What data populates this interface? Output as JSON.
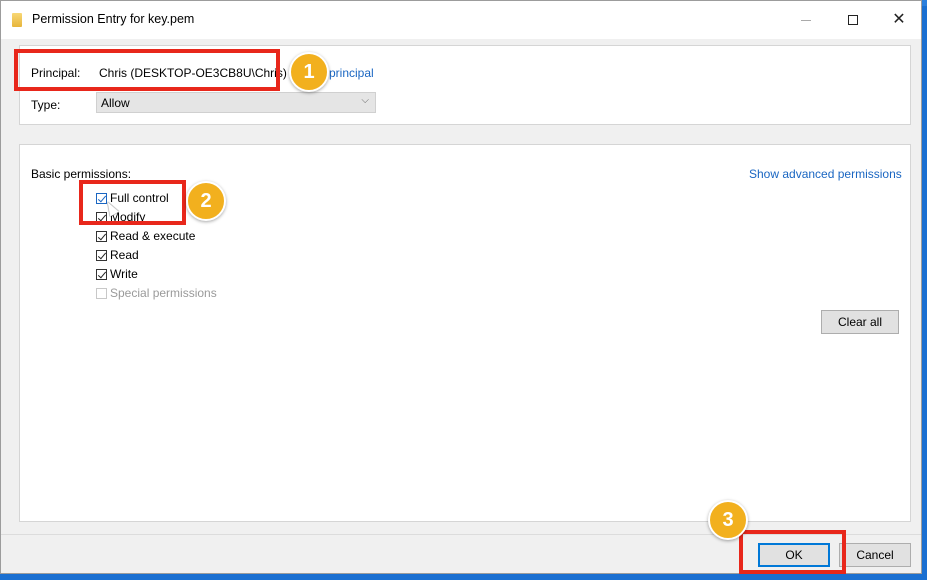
{
  "window": {
    "title": "Permission Entry for key.pem",
    "minimize_label": "—",
    "close_label": "✕"
  },
  "principal": {
    "label": "Principal:",
    "value": "Chris (DESKTOP-OE3CB8U\\Chris)",
    "select_link": "principal"
  },
  "type": {
    "label": "Type:",
    "value": "Allow"
  },
  "basic_permissions": {
    "label": "Basic permissions:",
    "show_advanced_link": "Show advanced permissions",
    "items": [
      {
        "label": "Full control",
        "checked": true
      },
      {
        "label": "Modify",
        "checked": true
      },
      {
        "label": "Read & execute",
        "checked": true
      },
      {
        "label": "Read",
        "checked": true
      },
      {
        "label": "Write",
        "checked": true
      },
      {
        "label": "Special permissions",
        "checked": false
      }
    ],
    "clear_all_label": "Clear all"
  },
  "footer": {
    "ok_label": "OK",
    "cancel_label": "Cancel"
  },
  "annotations": {
    "step1": "1",
    "step2": "2",
    "step3": "3",
    "highlight_color": "#e8271b",
    "badge_color": "#f2b01e"
  }
}
